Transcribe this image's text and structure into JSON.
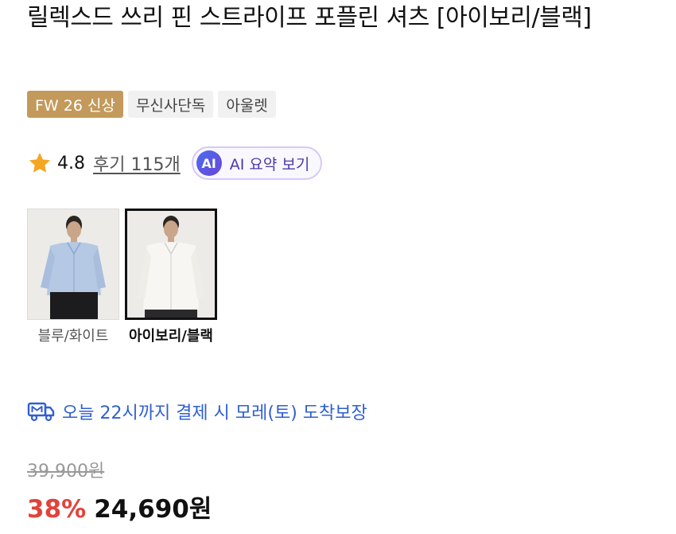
{
  "product": {
    "title": "릴렉스드 쓰리 핀 스트라이프 포플린 셔츠 [아이보리/블랙]"
  },
  "badges": [
    "FW 26 신상",
    "무신사단독",
    "아울렛"
  ],
  "rating": {
    "value": "4.8",
    "reviews_label": "후기 115개",
    "ai_icon": "AI",
    "ai_summary_label": "AI 요약 보기"
  },
  "colors": {
    "accent_gold": "#c39a5b",
    "delivery_blue": "#2f5fd1",
    "discount_red": "#e0433b",
    "ai_purple": "#4b3aa8"
  },
  "options": [
    {
      "label": "블루/화이트",
      "selected": false,
      "shirt_color": "#b5c8e4",
      "icon": "blue-shirt-thumbnail"
    },
    {
      "label": "아이보리/블랙",
      "selected": true,
      "shirt_color": "#f3f2ee",
      "icon": "ivory-shirt-thumbnail"
    }
  ],
  "delivery": {
    "icon": "truck-icon",
    "text": "오늘 22시까지 결제 시 모레(토) 도착보장"
  },
  "price": {
    "original": "39,900원",
    "discount": "38%",
    "final": "24,690원"
  }
}
